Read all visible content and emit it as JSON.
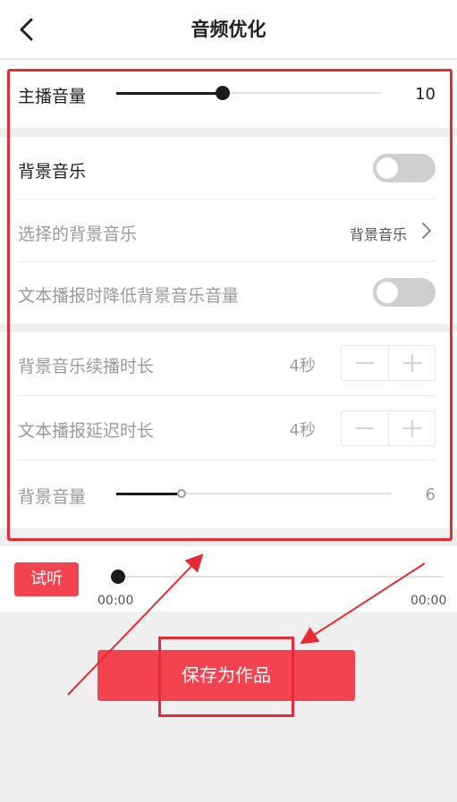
{
  "header": {
    "title": "音频优化"
  },
  "anchor_volume": {
    "label": "主播音量",
    "value": "10",
    "level": 0.39
  },
  "bg_music": {
    "label": "背景音乐",
    "enabled": false
  },
  "selected_music": {
    "label": "选择的背景音乐",
    "value": "背景音乐"
  },
  "duck_music": {
    "label": "文本播报时降低背景音乐音量",
    "enabled": false
  },
  "music_continue": {
    "label": "背景音乐续播时长",
    "value": "4秒"
  },
  "broadcast_delay": {
    "label": "文本播报延迟时长",
    "value": "4秒"
  },
  "bg_volume": {
    "label": "背景音量",
    "value": "6",
    "level": 0.24
  },
  "player": {
    "listen_label": "试听",
    "current_time": "00:00",
    "total_time": "00:00",
    "progress": 0
  },
  "save": {
    "label": "保存为作品"
  },
  "colors": {
    "accent": "#f2434e",
    "annotation": "#e82a35",
    "track_fill": "#1a1a1a",
    "toggle_off": "#cfcfcf"
  }
}
